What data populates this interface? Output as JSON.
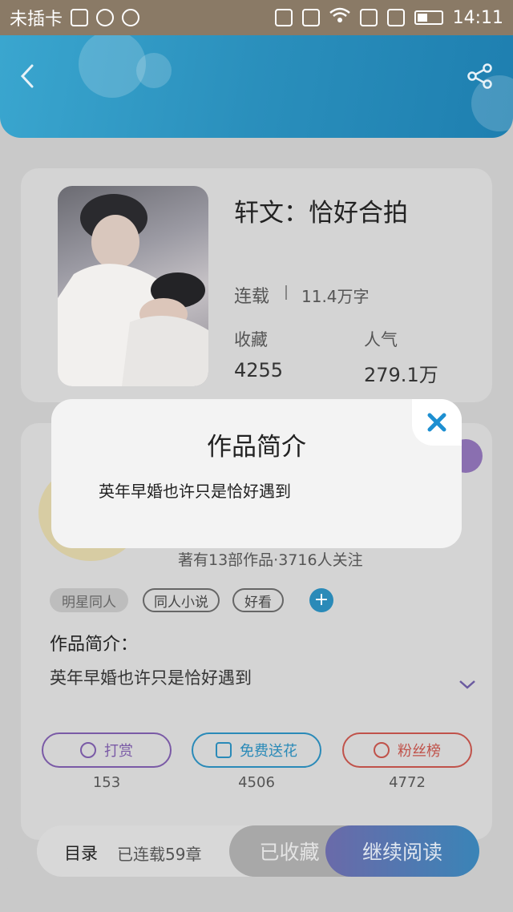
{
  "status_bar": {
    "carrier": "未插卡",
    "time": "14:11",
    "icons": [
      "sim-icon",
      "nfc-icon",
      "wifi-icon",
      "battery-icon"
    ]
  },
  "header": {
    "back_icon": "chevron-left-icon",
    "share_icon": "share-icon"
  },
  "book": {
    "title": "轩文：恰好合拍",
    "status": "连载",
    "word_count": "11.4万字",
    "favorites_label": "收藏",
    "favorites_value": "4255",
    "popularity_label": "人气",
    "popularity_value": "279.1万"
  },
  "author": {
    "summary": "著有13部作品·3716人关注"
  },
  "tags": [
    "明星同人",
    "同人小说",
    "好看"
  ],
  "intro": {
    "label": "作品简介：",
    "text": "英年早婚也许只是恰好遇到"
  },
  "actions": [
    {
      "label": "打赏",
      "count": "153",
      "color": "#7a5aa6"
    },
    {
      "label": "免费送花",
      "count": "4506",
      "color": "#2a8ab8"
    },
    {
      "label": "粉丝榜",
      "count": "4772",
      "color": "#c0524a"
    }
  ],
  "bottom_bar": {
    "toc_label": "目录",
    "toc_sub": "已连载59章",
    "favorited_label": "已收藏",
    "continue_label": "继续阅读"
  },
  "modal": {
    "title": "作品简介",
    "text": "英年早婚也许只是恰好遇到",
    "close_icon": "close-icon",
    "accent": "#1d8fd1"
  }
}
